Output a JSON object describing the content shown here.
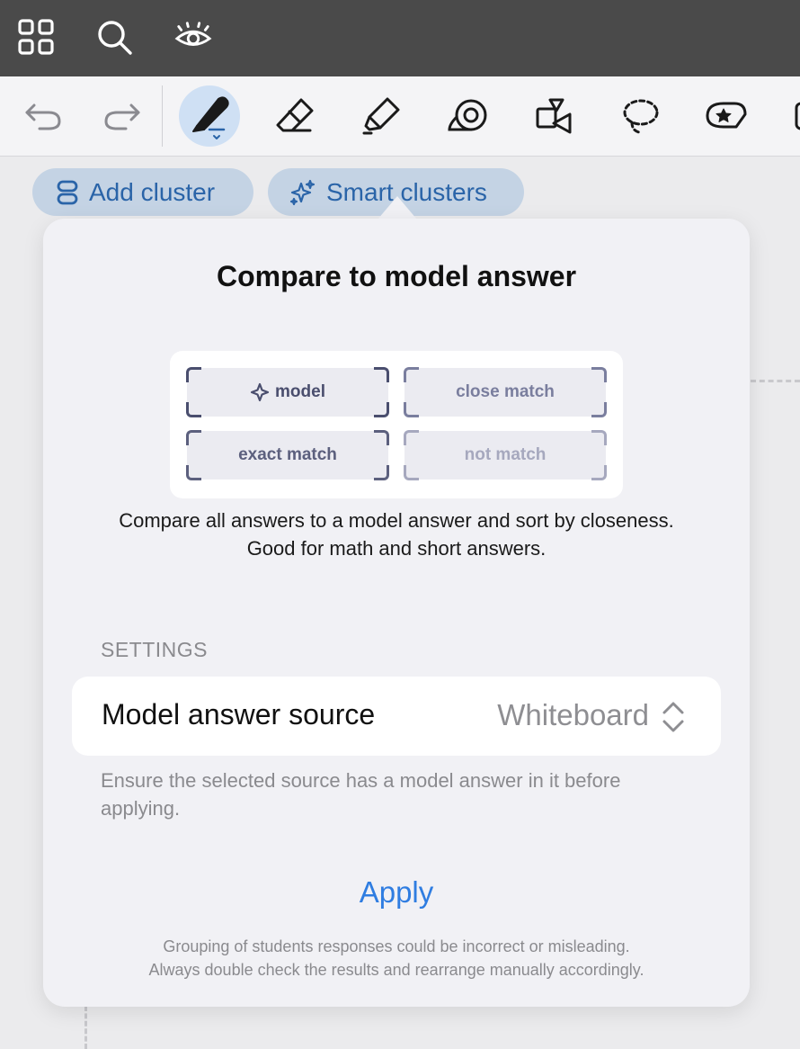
{
  "topbar": {
    "icons": [
      "grid-icon",
      "search-icon",
      "eye-icon"
    ]
  },
  "toolbar": {
    "tools": [
      "undo-icon",
      "redo-icon",
      "pen-icon",
      "eraser-icon",
      "highlighter-icon",
      "tape-icon",
      "shapes-icon",
      "lasso-icon",
      "sticker-icon"
    ],
    "active_tool": "pen-icon"
  },
  "chips": {
    "add_cluster": "Add cluster",
    "smart_clusters": "Smart clusters"
  },
  "popover": {
    "title": "Compare to model answer",
    "diagram": {
      "model": "model",
      "close_match": "close match",
      "exact_match": "exact match",
      "not_match": "not match"
    },
    "description": "Compare all answers to a model answer and sort by closeness. Good for math and short answers.",
    "settings_header": "SETTINGS",
    "source_label": "Model answer source",
    "source_value": "Whiteboard",
    "source_note": "Ensure the selected source has a model answer in it before applying.",
    "apply_label": "Apply",
    "disclaimer_line1": "Grouping of students responses could be incorrect or misleading.",
    "disclaimer_line2": "Always double check the results and rearrange manually accordingly."
  },
  "colors": {
    "accent": "#2f7de1",
    "chip_bg": "#c4d3e4",
    "chip_text": "#2a64a8",
    "topbar": "#4a4a4a",
    "active_tool_bg": "#cfe0f4"
  }
}
